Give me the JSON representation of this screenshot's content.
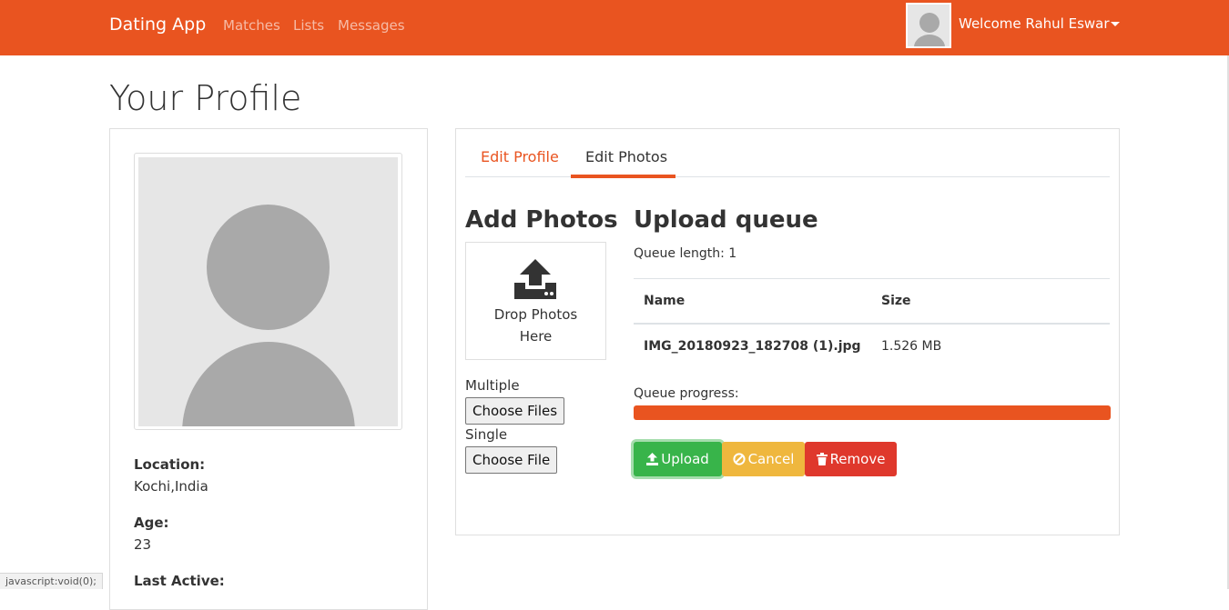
{
  "navbar": {
    "brand": "Dating App",
    "links": [
      "Matches",
      "Lists",
      "Messages"
    ],
    "welcome": "Welcome Rahul Eswar"
  },
  "page_title": "Your Profile",
  "profile": {
    "location_label": "Location:",
    "location_value": "Kochi,India",
    "age_label": "Age:",
    "age_value": "23",
    "last_active_label": "Last Active:"
  },
  "tabs": [
    {
      "label": "Edit Profile",
      "active": false
    },
    {
      "label": "Edit Photos",
      "active": true
    }
  ],
  "add_photos": {
    "heading": "Add Photos",
    "dropzone_text_line1": "Drop Photos",
    "dropzone_text_line2": "Here",
    "multiple_label": "Multiple",
    "multiple_button": "Choose Files",
    "single_label": "Single",
    "single_button": "Choose File"
  },
  "queue": {
    "heading": "Upload queue",
    "length_text": "Queue length: 1",
    "columns": [
      "Name",
      "Size"
    ],
    "rows": [
      {
        "name": "IMG_20180923_182708 (1).jpg",
        "size": "1.526 MB"
      }
    ],
    "progress_label": "Queue progress:",
    "progress_fraction": 1.0
  },
  "buttons": {
    "upload": "Upload",
    "cancel": "Cancel",
    "remove": "Remove"
  },
  "status_bar": "javascript:void(0);",
  "colors": {
    "primary": "#e95420",
    "success": "#38b44a",
    "warning": "#efb73e",
    "danger": "#df382c"
  }
}
